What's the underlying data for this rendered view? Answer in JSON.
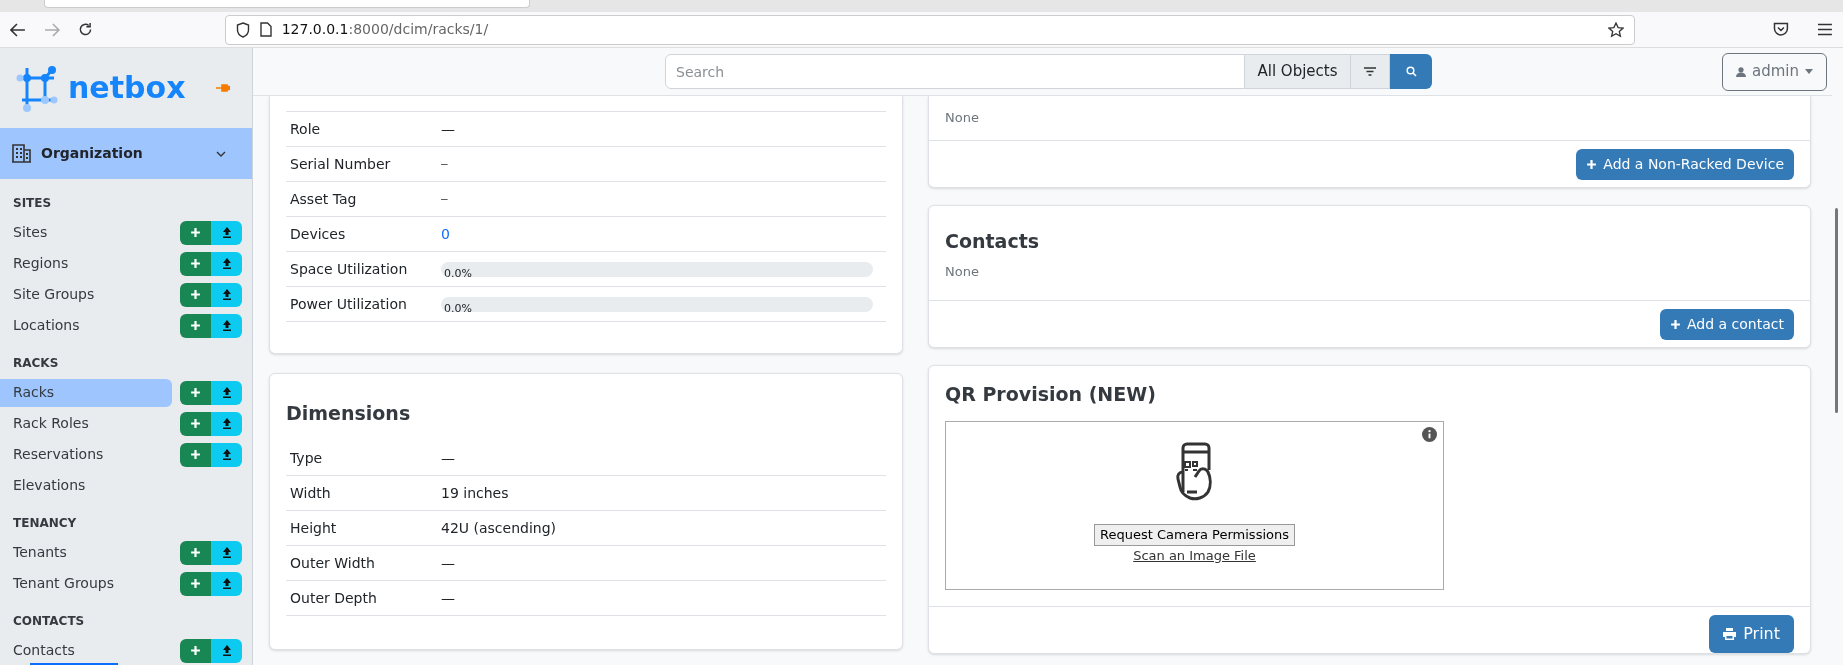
{
  "browser": {
    "url_host": "127.0.0.1",
    "url_path": ":8000/dcim/racks/1/"
  },
  "sidebar": {
    "brand": "netbox",
    "menu": {
      "label": "Organization",
      "expanded": true
    },
    "sections": [
      {
        "heading": "SITES",
        "items": [
          {
            "label": "Sites",
            "selected": false,
            "has_actions": true
          },
          {
            "label": "Regions",
            "selected": false,
            "has_actions": true
          },
          {
            "label": "Site Groups",
            "selected": false,
            "has_actions": true
          },
          {
            "label": "Locations",
            "selected": false,
            "has_actions": true
          }
        ]
      },
      {
        "heading": "RACKS",
        "items": [
          {
            "label": "Racks",
            "selected": true,
            "has_actions": true
          },
          {
            "label": "Rack Roles",
            "selected": false,
            "has_actions": true
          },
          {
            "label": "Reservations",
            "selected": false,
            "has_actions": true
          },
          {
            "label": "Elevations",
            "selected": false,
            "has_actions": false
          }
        ]
      },
      {
        "heading": "TENANCY",
        "items": [
          {
            "label": "Tenants",
            "selected": false,
            "has_actions": true
          },
          {
            "label": "Tenant Groups",
            "selected": false,
            "has_actions": true
          }
        ]
      },
      {
        "heading": "CONTACTS",
        "items": [
          {
            "label": "Contacts",
            "selected": false,
            "has_actions": true
          }
        ]
      }
    ]
  },
  "navbar": {
    "search_placeholder": "Search",
    "scope": "All Objects",
    "user": "admin"
  },
  "rack_card": {
    "rows": [
      {
        "label": "Role",
        "value": "—",
        "kind": "text"
      },
      {
        "label": "Serial Number",
        "value": "—",
        "kind": "mono"
      },
      {
        "label": "Asset Tag",
        "value": "—",
        "kind": "mono"
      },
      {
        "label": "Devices",
        "value": "0",
        "kind": "link"
      },
      {
        "label": "Space Utilization",
        "value": "0.0%",
        "kind": "progress",
        "level": 0
      },
      {
        "label": "Power Utilization",
        "value": "0.0%",
        "kind": "progress",
        "level": 0
      }
    ]
  },
  "dimensions_card": {
    "title": "Dimensions",
    "rows": [
      {
        "label": "Type",
        "value": "—",
        "kind": "text"
      },
      {
        "label": "Width",
        "value": "19 inches",
        "kind": "text"
      },
      {
        "label": "Height",
        "value": "42U (ascending)",
        "kind": "text"
      },
      {
        "label": "Outer Width",
        "value": "—",
        "kind": "text"
      },
      {
        "label": "Outer Depth",
        "value": "—",
        "kind": "text"
      }
    ]
  },
  "devices_card": {
    "text": "None",
    "button": "Add a Non-Racked Device"
  },
  "contacts_card": {
    "title": "Contacts",
    "text": "None",
    "button": "Add a contact"
  },
  "qr_card": {
    "title": "QR Provision (NEW)",
    "camera_button": "Request Camera Permissions",
    "scan_link": "Scan an Image File",
    "print_button": "Print"
  }
}
